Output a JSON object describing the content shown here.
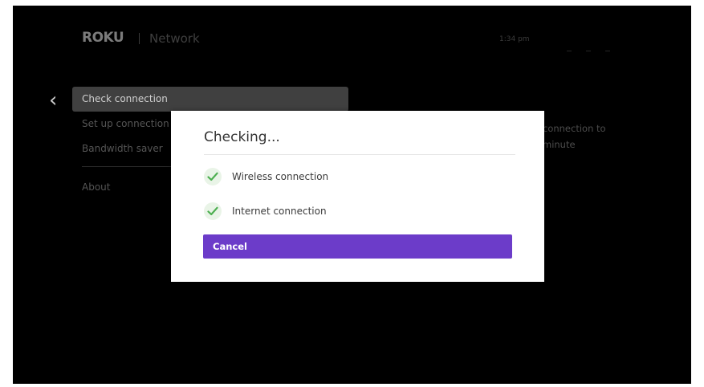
{
  "header": {
    "brand": "ROKU",
    "section_title": "Network",
    "clock": "1:34 pm"
  },
  "nav": {
    "back_icon": "chevron-left-icon"
  },
  "menu": {
    "items": [
      {
        "label": "Check connection",
        "selected": true
      },
      {
        "label": "Set up connection",
        "selected": false
      },
      {
        "label": "Bandwidth saver",
        "selected": false
      },
      {
        "label": "About",
        "selected": false
      }
    ]
  },
  "right_panel": {
    "line1": "connection to",
    "line2": "minute"
  },
  "dialog": {
    "title": "Checking...",
    "checks": [
      {
        "label": "Wireless connection",
        "status": "ok",
        "icon": "check-circle-icon"
      },
      {
        "label": "Internet connection",
        "status": "ok",
        "icon": "check-circle-icon"
      }
    ],
    "cancel_label": "Cancel"
  },
  "colors": {
    "accent": "#6c3cc9",
    "check_green": "#4caf50",
    "background": "#000000"
  }
}
